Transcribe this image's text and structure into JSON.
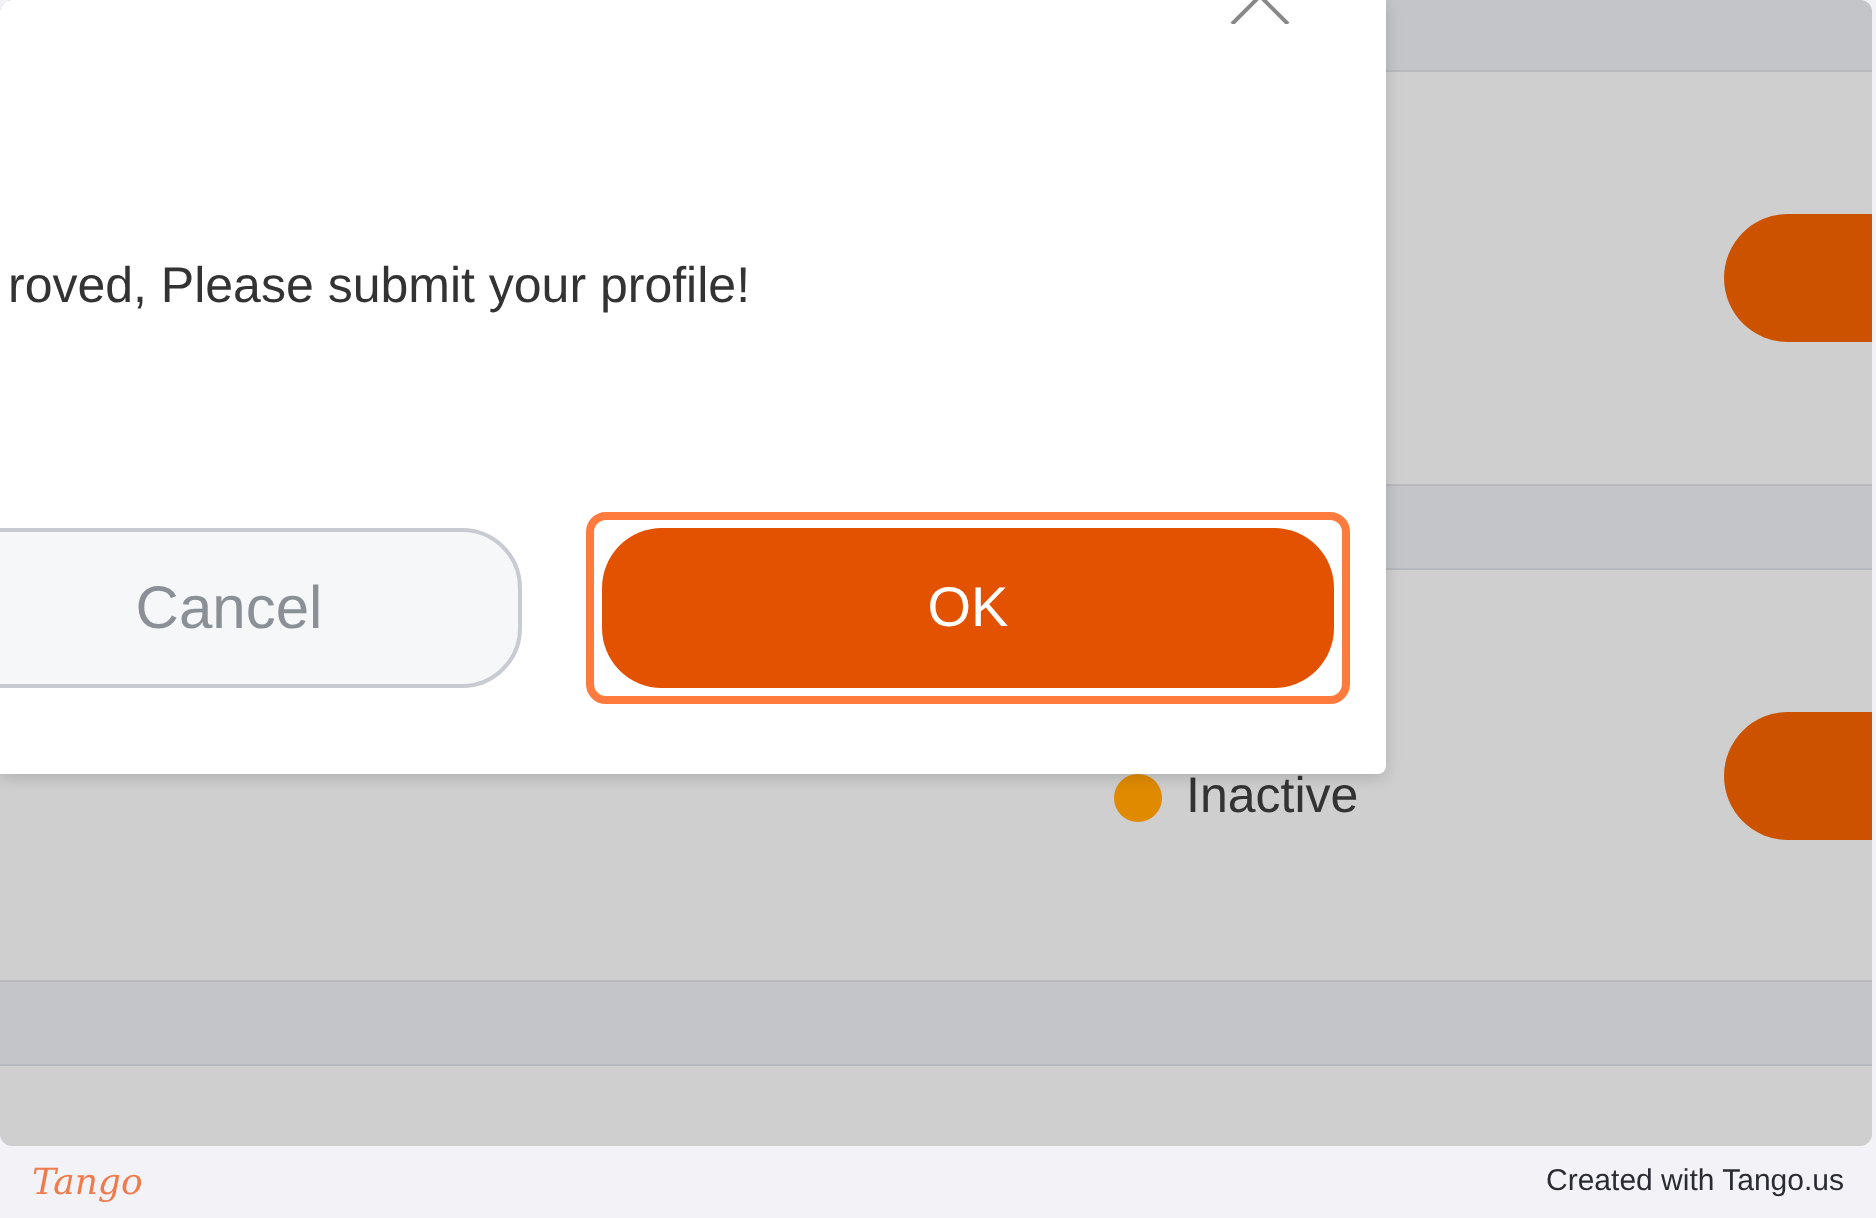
{
  "page": {
    "status": {
      "label": "Inactive",
      "color": "#e08a00"
    }
  },
  "dialog": {
    "message": "roved, Please submit your profile!",
    "buttons": [
      {
        "label": "Cancel",
        "kind": "secondary"
      },
      {
        "label": "OK",
        "kind": "primary",
        "highlighted": true
      }
    ]
  },
  "footer": {
    "logo": "Tango",
    "credit": "Created with Tango.us"
  }
}
